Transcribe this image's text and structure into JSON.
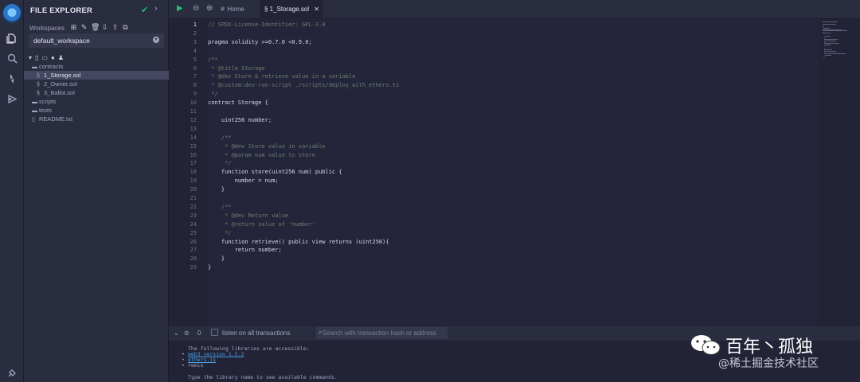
{
  "rail": {
    "icons": [
      "remix-logo-icon",
      "file-explorer-icon",
      "search-icon",
      "solidity-compiler-icon",
      "deploy-run-icon",
      "settings-plug-icon"
    ]
  },
  "explorer": {
    "title": "FILE EXPLORER",
    "workspaces_label": "Workspaces",
    "workspace_name": "default_workspace",
    "tree": [
      {
        "name": "contracts",
        "type": "folder",
        "depth": 1
      },
      {
        "name": "1_Storage.sol",
        "type": "file",
        "depth": 2,
        "selected": true
      },
      {
        "name": "2_Owner.sol",
        "type": "file",
        "depth": 2
      },
      {
        "name": "3_Ballot.sol",
        "type": "file",
        "depth": 2
      },
      {
        "name": "scripts",
        "type": "folder",
        "depth": 1
      },
      {
        "name": "tests",
        "type": "folder",
        "depth": 1
      },
      {
        "name": "README.txt",
        "type": "file",
        "depth": 1
      }
    ]
  },
  "tabs": {
    "home": "Home",
    "file": "1_Storage.sol"
  },
  "code": [
    {
      "n": "1",
      "t": "// SPDX-License-Identifier: GPL-3.0",
      "c": "#6c7f71"
    },
    {
      "n": "2",
      "t": "",
      "c": "#d8d9ea"
    },
    {
      "n": "3",
      "t": "pragma solidity >=0.7.0 <0.9.0;",
      "c": "#d8d9ea"
    },
    {
      "n": "4",
      "t": "",
      "c": "#d8d9ea"
    },
    {
      "n": "5",
      "t": "/**",
      "c": "#6c7f71"
    },
    {
      "n": "6",
      "t": " * @title Storage",
      "c": "#6c7f71"
    },
    {
      "n": "7",
      "t": " * @dev Store & retrieve value in a variable",
      "c": "#6c7f71"
    },
    {
      "n": "8",
      "t": " * @custom:dev-run-script ./scripts/deploy_with_ethers.ts",
      "c": "#6c7f71"
    },
    {
      "n": "9",
      "t": " */",
      "c": "#6c7f71"
    },
    {
      "n": "10",
      "t": "contract Storage {",
      "c": "#d8d9ea"
    },
    {
      "n": "11",
      "t": "",
      "c": "#d8d9ea"
    },
    {
      "n": "12",
      "t": "    uint256 number;",
      "c": "#d8d9ea"
    },
    {
      "n": "13",
      "t": "",
      "c": "#d8d9ea"
    },
    {
      "n": "14",
      "t": "    /**",
      "c": "#6c7f71"
    },
    {
      "n": "15",
      "t": "     * @dev Store value in variable",
      "c": "#6c7f71"
    },
    {
      "n": "16",
      "t": "     * @param num value to store",
      "c": "#6c7f71"
    },
    {
      "n": "17",
      "t": "     */",
      "c": "#6c7f71"
    },
    {
      "n": "18",
      "t": "    function store(uint256 num) public {",
      "c": "#d8d9ea"
    },
    {
      "n": "19",
      "t": "        number = num;",
      "c": "#d8d9ea"
    },
    {
      "n": "20",
      "t": "    }",
      "c": "#d8d9ea"
    },
    {
      "n": "21",
      "t": "",
      "c": "#d8d9ea"
    },
    {
      "n": "22",
      "t": "    /**",
      "c": "#6c7f71"
    },
    {
      "n": "23",
      "t": "     * @dev Return value",
      "c": "#6c7f71"
    },
    {
      "n": "24",
      "t": "     * @return value of 'number'",
      "c": "#6c7f71"
    },
    {
      "n": "25",
      "t": "     */",
      "c": "#6c7f71"
    },
    {
      "n": "26",
      "t": "    function retrieve() public view returns (uint256){",
      "c": "#d8d9ea"
    },
    {
      "n": "27",
      "t": "        return number;",
      "c": "#d8d9ea"
    },
    {
      "n": "28",
      "t": "    }",
      "c": "#d8d9ea"
    },
    {
      "n": "29",
      "t": "}",
      "c": "#d8d9ea"
    }
  ],
  "terminal_bar": {
    "count": "0",
    "listen_label": "listen on all transactions",
    "search_placeholder": "Search with transaction hash or address"
  },
  "terminal": {
    "intro": "The following libraries are accessible:",
    "libs": [
      "web3 version 1.5.2",
      "ethers.js",
      "remix"
    ],
    "hint": "Type the library name to see available commands."
  },
  "watermark": {
    "title": "百年丶孤独",
    "sub": "@稀土掘金技术社区"
  },
  "colors": {
    "background": "#222336",
    "panel": "#2a2c3f",
    "accent_green": "#1ec174",
    "link": "#49a2e4",
    "keyword": "#3f9dd6",
    "comment": "#6c7f71"
  }
}
